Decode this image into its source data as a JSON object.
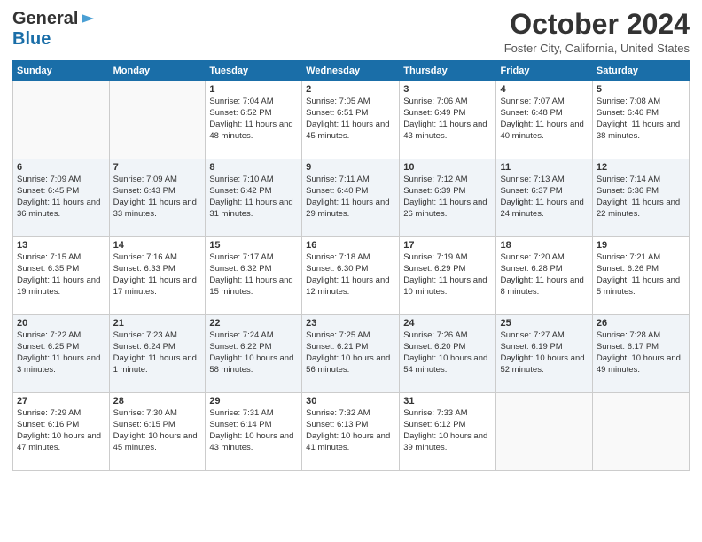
{
  "logo": {
    "line1": "General",
    "line2": "Blue"
  },
  "title": "October 2024",
  "location": "Foster City, California, United States",
  "days_header": [
    "Sunday",
    "Monday",
    "Tuesday",
    "Wednesday",
    "Thursday",
    "Friday",
    "Saturday"
  ],
  "weeks": [
    [
      {
        "day": "",
        "info": ""
      },
      {
        "day": "",
        "info": ""
      },
      {
        "day": "1",
        "info": "Sunrise: 7:04 AM\nSunset: 6:52 PM\nDaylight: 11 hours and 48 minutes."
      },
      {
        "day": "2",
        "info": "Sunrise: 7:05 AM\nSunset: 6:51 PM\nDaylight: 11 hours and 45 minutes."
      },
      {
        "day": "3",
        "info": "Sunrise: 7:06 AM\nSunset: 6:49 PM\nDaylight: 11 hours and 43 minutes."
      },
      {
        "day": "4",
        "info": "Sunrise: 7:07 AM\nSunset: 6:48 PM\nDaylight: 11 hours and 40 minutes."
      },
      {
        "day": "5",
        "info": "Sunrise: 7:08 AM\nSunset: 6:46 PM\nDaylight: 11 hours and 38 minutes."
      }
    ],
    [
      {
        "day": "6",
        "info": "Sunrise: 7:09 AM\nSunset: 6:45 PM\nDaylight: 11 hours and 36 minutes."
      },
      {
        "day": "7",
        "info": "Sunrise: 7:09 AM\nSunset: 6:43 PM\nDaylight: 11 hours and 33 minutes."
      },
      {
        "day": "8",
        "info": "Sunrise: 7:10 AM\nSunset: 6:42 PM\nDaylight: 11 hours and 31 minutes."
      },
      {
        "day": "9",
        "info": "Sunrise: 7:11 AM\nSunset: 6:40 PM\nDaylight: 11 hours and 29 minutes."
      },
      {
        "day": "10",
        "info": "Sunrise: 7:12 AM\nSunset: 6:39 PM\nDaylight: 11 hours and 26 minutes."
      },
      {
        "day": "11",
        "info": "Sunrise: 7:13 AM\nSunset: 6:37 PM\nDaylight: 11 hours and 24 minutes."
      },
      {
        "day": "12",
        "info": "Sunrise: 7:14 AM\nSunset: 6:36 PM\nDaylight: 11 hours and 22 minutes."
      }
    ],
    [
      {
        "day": "13",
        "info": "Sunrise: 7:15 AM\nSunset: 6:35 PM\nDaylight: 11 hours and 19 minutes."
      },
      {
        "day": "14",
        "info": "Sunrise: 7:16 AM\nSunset: 6:33 PM\nDaylight: 11 hours and 17 minutes."
      },
      {
        "day": "15",
        "info": "Sunrise: 7:17 AM\nSunset: 6:32 PM\nDaylight: 11 hours and 15 minutes."
      },
      {
        "day": "16",
        "info": "Sunrise: 7:18 AM\nSunset: 6:30 PM\nDaylight: 11 hours and 12 minutes."
      },
      {
        "day": "17",
        "info": "Sunrise: 7:19 AM\nSunset: 6:29 PM\nDaylight: 11 hours and 10 minutes."
      },
      {
        "day": "18",
        "info": "Sunrise: 7:20 AM\nSunset: 6:28 PM\nDaylight: 11 hours and 8 minutes."
      },
      {
        "day": "19",
        "info": "Sunrise: 7:21 AM\nSunset: 6:26 PM\nDaylight: 11 hours and 5 minutes."
      }
    ],
    [
      {
        "day": "20",
        "info": "Sunrise: 7:22 AM\nSunset: 6:25 PM\nDaylight: 11 hours and 3 minutes."
      },
      {
        "day": "21",
        "info": "Sunrise: 7:23 AM\nSunset: 6:24 PM\nDaylight: 11 hours and 1 minute."
      },
      {
        "day": "22",
        "info": "Sunrise: 7:24 AM\nSunset: 6:22 PM\nDaylight: 10 hours and 58 minutes."
      },
      {
        "day": "23",
        "info": "Sunrise: 7:25 AM\nSunset: 6:21 PM\nDaylight: 10 hours and 56 minutes."
      },
      {
        "day": "24",
        "info": "Sunrise: 7:26 AM\nSunset: 6:20 PM\nDaylight: 10 hours and 54 minutes."
      },
      {
        "day": "25",
        "info": "Sunrise: 7:27 AM\nSunset: 6:19 PM\nDaylight: 10 hours and 52 minutes."
      },
      {
        "day": "26",
        "info": "Sunrise: 7:28 AM\nSunset: 6:17 PM\nDaylight: 10 hours and 49 minutes."
      }
    ],
    [
      {
        "day": "27",
        "info": "Sunrise: 7:29 AM\nSunset: 6:16 PM\nDaylight: 10 hours and 47 minutes."
      },
      {
        "day": "28",
        "info": "Sunrise: 7:30 AM\nSunset: 6:15 PM\nDaylight: 10 hours and 45 minutes."
      },
      {
        "day": "29",
        "info": "Sunrise: 7:31 AM\nSunset: 6:14 PM\nDaylight: 10 hours and 43 minutes."
      },
      {
        "day": "30",
        "info": "Sunrise: 7:32 AM\nSunset: 6:13 PM\nDaylight: 10 hours and 41 minutes."
      },
      {
        "day": "31",
        "info": "Sunrise: 7:33 AM\nSunset: 6:12 PM\nDaylight: 10 hours and 39 minutes."
      },
      {
        "day": "",
        "info": ""
      },
      {
        "day": "",
        "info": ""
      }
    ]
  ]
}
